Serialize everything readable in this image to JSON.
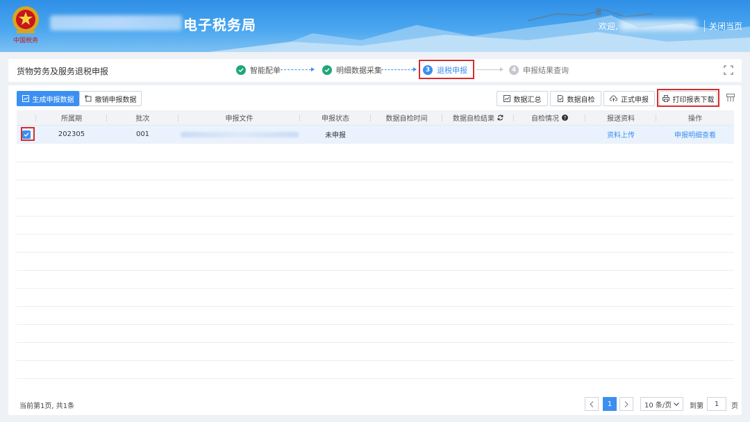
{
  "header": {
    "site_title": "电子税务局",
    "welcome": "欢迎,",
    "close_page": "关闭当页"
  },
  "steps": {
    "page_title": "货物劳务及服务退税申报",
    "items": [
      {
        "label": "智能配单",
        "num": "",
        "state": "done"
      },
      {
        "label": "明细数据采集",
        "num": "",
        "state": "done"
      },
      {
        "label": "退税申报",
        "num": "3",
        "state": "active"
      },
      {
        "label": "申报结果查询",
        "num": "4",
        "state": "pending"
      }
    ]
  },
  "toolbar": {
    "generate": "生成申报数据",
    "revoke": "撤销申报数据",
    "summary": "数据汇总",
    "selfcheck": "数据自检",
    "formal": "正式申报",
    "print": "打印报表下载"
  },
  "table": {
    "headers": [
      "所属期",
      "批次",
      "申报文件",
      "申报状态",
      "数据自检时间",
      "数据自检结果",
      "自检情况",
      "报送资料",
      "操作"
    ],
    "rows": [
      {
        "period": "202305",
        "batch": "001",
        "status": "未申报",
        "check_time": "",
        "check_result": "",
        "check_info": "",
        "material": "资料上传",
        "action": "申报明细查看"
      }
    ]
  },
  "footer": {
    "summary": "当前第1页, 共1条",
    "current_page": "1",
    "page_size": "10 条/页",
    "goto_label": "到第",
    "goto_value": "1",
    "page_unit": "页"
  },
  "colors": {
    "accent": "#3b8ff0",
    "success": "#1fa67a",
    "highlight": "#d62b2b"
  }
}
